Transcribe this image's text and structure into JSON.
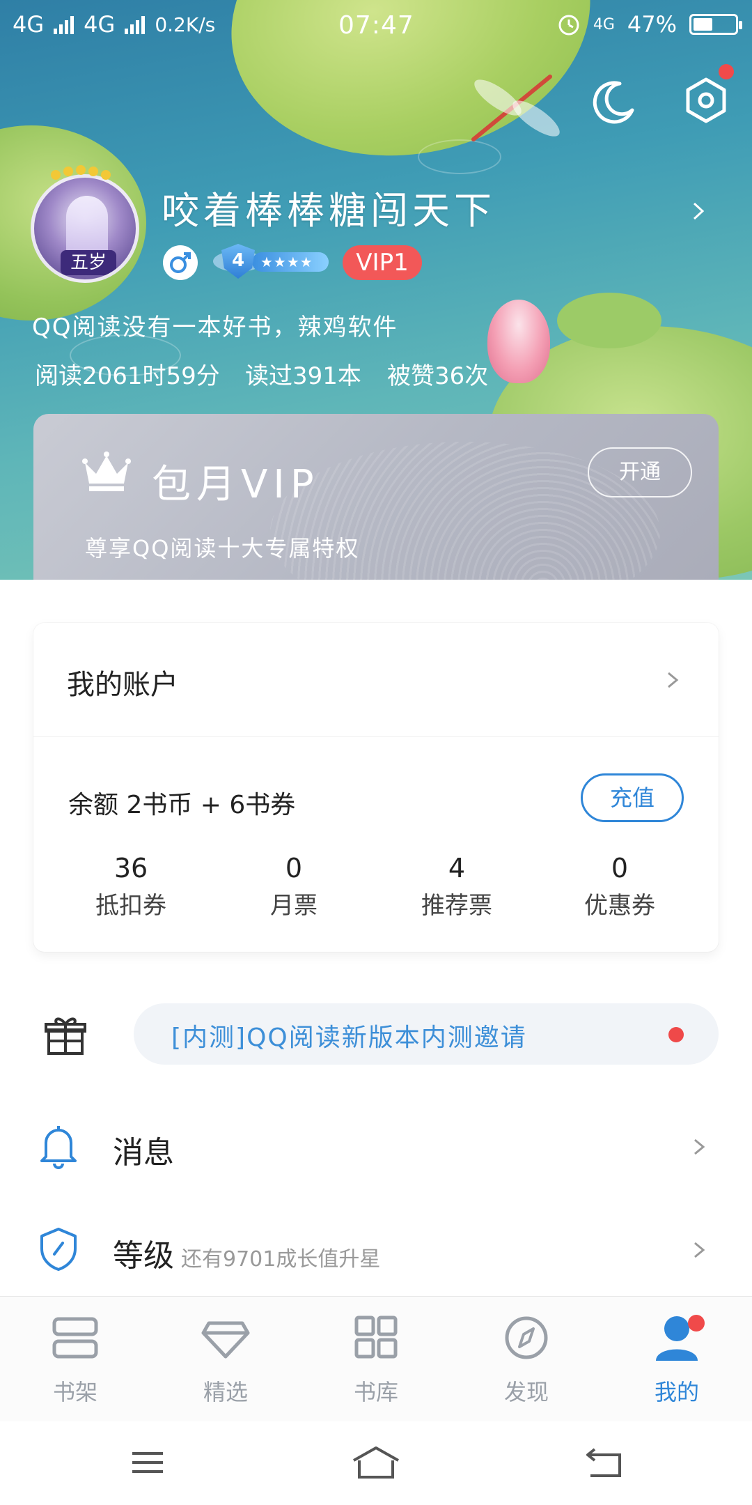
{
  "status_bar": {
    "network1": "4G",
    "network2": "4G",
    "speed": "0.2K/s",
    "time": "07:47",
    "network3": "4G",
    "battery": "47%",
    "battery_level": 0.47
  },
  "profile": {
    "avatar_text": "五岁",
    "username": "咬着棒棒糖闯天下",
    "level": "4",
    "level_stars": "★★★★",
    "vip_badge": "VIP1",
    "bio": "QQ阅读没有一本好书，辣鸡软件",
    "stats": {
      "read_time": "阅读2061时59分",
      "books_read": "读过391本",
      "likes": "被赞36次"
    }
  },
  "vip_card": {
    "title": "包月VIP",
    "subtitle": "尊享QQ阅读十大专属特权",
    "open_button": "开通"
  },
  "account": {
    "title": "我的账户",
    "balance": "余额   2书币 + 6书券",
    "recharge_button": "充值",
    "items": [
      {
        "value": "36",
        "label": "抵扣券"
      },
      {
        "value": "0",
        "label": "月票"
      },
      {
        "value": "4",
        "label": "推荐票"
      },
      {
        "value": "0",
        "label": "优惠券"
      }
    ]
  },
  "invite": {
    "text": "[内测]QQ阅读新版本内测邀请"
  },
  "menu": {
    "messages": "消息",
    "level_label": "等级",
    "level_sub": "还有9701成长值升星"
  },
  "tabs": [
    {
      "label": "书架",
      "icon": "bookshelf-icon"
    },
    {
      "label": "精选",
      "icon": "diamond-icon"
    },
    {
      "label": "书库",
      "icon": "grid-icon"
    },
    {
      "label": "发现",
      "icon": "compass-icon"
    },
    {
      "label": "我的",
      "icon": "user-icon",
      "active": true
    }
  ],
  "colors": {
    "accent": "#2f86d8",
    "badge_red": "#f04a4a",
    "vip_card": "#b5b8c4"
  }
}
